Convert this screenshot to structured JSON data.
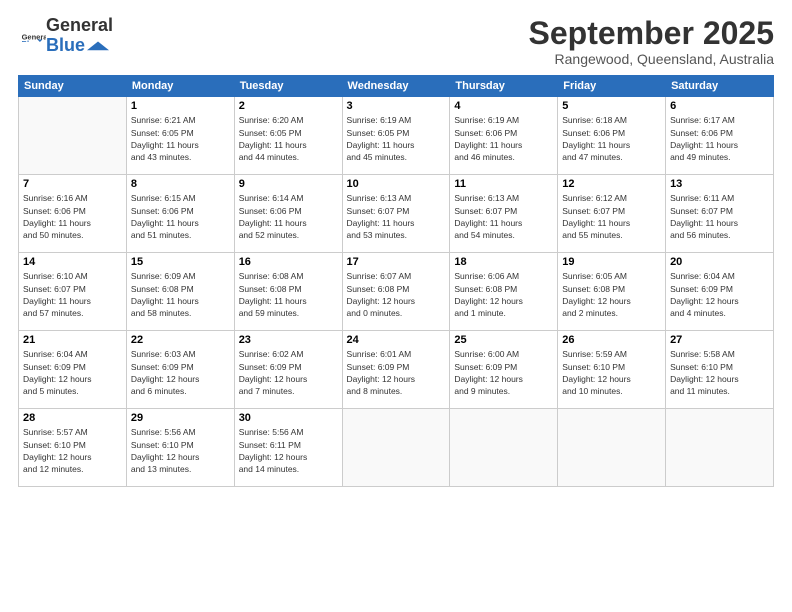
{
  "header": {
    "logo_general": "General",
    "logo_blue": "Blue",
    "month": "September 2025",
    "location": "Rangewood, Queensland, Australia"
  },
  "weekdays": [
    "Sunday",
    "Monday",
    "Tuesday",
    "Wednesday",
    "Thursday",
    "Friday",
    "Saturday"
  ],
  "weeks": [
    [
      {
        "day": "",
        "info": ""
      },
      {
        "day": "1",
        "info": "Sunrise: 6:21 AM\nSunset: 6:05 PM\nDaylight: 11 hours\nand 43 minutes."
      },
      {
        "day": "2",
        "info": "Sunrise: 6:20 AM\nSunset: 6:05 PM\nDaylight: 11 hours\nand 44 minutes."
      },
      {
        "day": "3",
        "info": "Sunrise: 6:19 AM\nSunset: 6:05 PM\nDaylight: 11 hours\nand 45 minutes."
      },
      {
        "day": "4",
        "info": "Sunrise: 6:19 AM\nSunset: 6:06 PM\nDaylight: 11 hours\nand 46 minutes."
      },
      {
        "day": "5",
        "info": "Sunrise: 6:18 AM\nSunset: 6:06 PM\nDaylight: 11 hours\nand 47 minutes."
      },
      {
        "day": "6",
        "info": "Sunrise: 6:17 AM\nSunset: 6:06 PM\nDaylight: 11 hours\nand 49 minutes."
      }
    ],
    [
      {
        "day": "7",
        "info": "Sunrise: 6:16 AM\nSunset: 6:06 PM\nDaylight: 11 hours\nand 50 minutes."
      },
      {
        "day": "8",
        "info": "Sunrise: 6:15 AM\nSunset: 6:06 PM\nDaylight: 11 hours\nand 51 minutes."
      },
      {
        "day": "9",
        "info": "Sunrise: 6:14 AM\nSunset: 6:06 PM\nDaylight: 11 hours\nand 52 minutes."
      },
      {
        "day": "10",
        "info": "Sunrise: 6:13 AM\nSunset: 6:07 PM\nDaylight: 11 hours\nand 53 minutes."
      },
      {
        "day": "11",
        "info": "Sunrise: 6:13 AM\nSunset: 6:07 PM\nDaylight: 11 hours\nand 54 minutes."
      },
      {
        "day": "12",
        "info": "Sunrise: 6:12 AM\nSunset: 6:07 PM\nDaylight: 11 hours\nand 55 minutes."
      },
      {
        "day": "13",
        "info": "Sunrise: 6:11 AM\nSunset: 6:07 PM\nDaylight: 11 hours\nand 56 minutes."
      }
    ],
    [
      {
        "day": "14",
        "info": "Sunrise: 6:10 AM\nSunset: 6:07 PM\nDaylight: 11 hours\nand 57 minutes."
      },
      {
        "day": "15",
        "info": "Sunrise: 6:09 AM\nSunset: 6:08 PM\nDaylight: 11 hours\nand 58 minutes."
      },
      {
        "day": "16",
        "info": "Sunrise: 6:08 AM\nSunset: 6:08 PM\nDaylight: 11 hours\nand 59 minutes."
      },
      {
        "day": "17",
        "info": "Sunrise: 6:07 AM\nSunset: 6:08 PM\nDaylight: 12 hours\nand 0 minutes."
      },
      {
        "day": "18",
        "info": "Sunrise: 6:06 AM\nSunset: 6:08 PM\nDaylight: 12 hours\nand 1 minute."
      },
      {
        "day": "19",
        "info": "Sunrise: 6:05 AM\nSunset: 6:08 PM\nDaylight: 12 hours\nand 2 minutes."
      },
      {
        "day": "20",
        "info": "Sunrise: 6:04 AM\nSunset: 6:09 PM\nDaylight: 12 hours\nand 4 minutes."
      }
    ],
    [
      {
        "day": "21",
        "info": "Sunrise: 6:04 AM\nSunset: 6:09 PM\nDaylight: 12 hours\nand 5 minutes."
      },
      {
        "day": "22",
        "info": "Sunrise: 6:03 AM\nSunset: 6:09 PM\nDaylight: 12 hours\nand 6 minutes."
      },
      {
        "day": "23",
        "info": "Sunrise: 6:02 AM\nSunset: 6:09 PM\nDaylight: 12 hours\nand 7 minutes."
      },
      {
        "day": "24",
        "info": "Sunrise: 6:01 AM\nSunset: 6:09 PM\nDaylight: 12 hours\nand 8 minutes."
      },
      {
        "day": "25",
        "info": "Sunrise: 6:00 AM\nSunset: 6:09 PM\nDaylight: 12 hours\nand 9 minutes."
      },
      {
        "day": "26",
        "info": "Sunrise: 5:59 AM\nSunset: 6:10 PM\nDaylight: 12 hours\nand 10 minutes."
      },
      {
        "day": "27",
        "info": "Sunrise: 5:58 AM\nSunset: 6:10 PM\nDaylight: 12 hours\nand 11 minutes."
      }
    ],
    [
      {
        "day": "28",
        "info": "Sunrise: 5:57 AM\nSunset: 6:10 PM\nDaylight: 12 hours\nand 12 minutes."
      },
      {
        "day": "29",
        "info": "Sunrise: 5:56 AM\nSunset: 6:10 PM\nDaylight: 12 hours\nand 13 minutes."
      },
      {
        "day": "30",
        "info": "Sunrise: 5:56 AM\nSunset: 6:11 PM\nDaylight: 12 hours\nand 14 minutes."
      },
      {
        "day": "",
        "info": ""
      },
      {
        "day": "",
        "info": ""
      },
      {
        "day": "",
        "info": ""
      },
      {
        "day": "",
        "info": ""
      }
    ]
  ]
}
